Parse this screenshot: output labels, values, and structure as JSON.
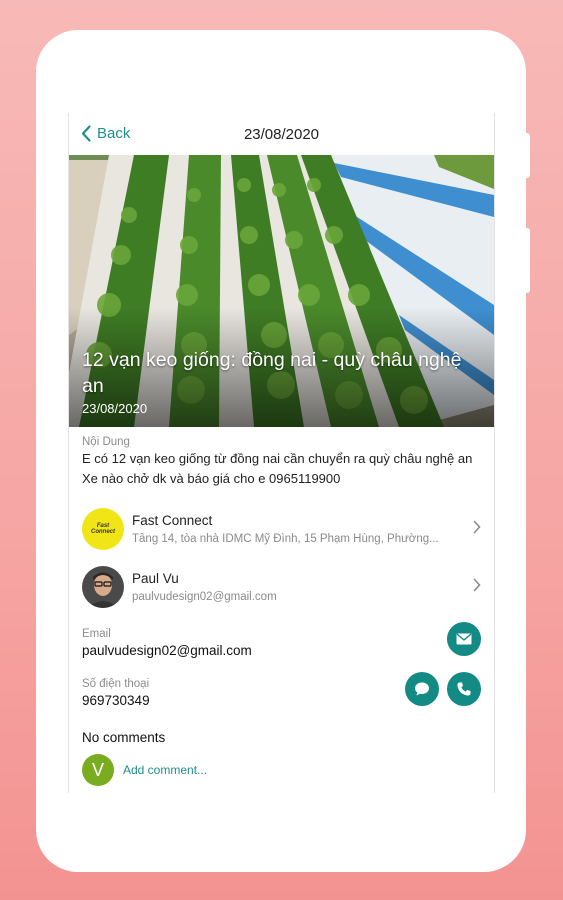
{
  "header": {
    "back_label": "Back",
    "date": "23/08/2020"
  },
  "post": {
    "title": "12 vạn keo giống: đồng nai  - quỳ châu nghệ an",
    "date": "23/08/2020",
    "content_label": "Nội Dung",
    "content_line1": "E có 12 vạn keo giống từ đồng nai cần chuyển ra quỳ châu nghệ an",
    "content_line2": "Xe nào chở dk và báo giá cho e 0965119900"
  },
  "company": {
    "logo_text_1": "Fast",
    "logo_text_2": "Connect",
    "name": "Fast Connect",
    "address": "Tầng 14, tòa nhà IDMC Mỹ Đình, 15 Phạm Hùng, Phường..."
  },
  "user": {
    "name": "Paul Vu",
    "email": "paulvudesign02@gmail.com"
  },
  "contact": {
    "email_label": "Email",
    "email_value": "paulvudesign02@gmail.com",
    "phone_label": "Số điện thoại",
    "phone_value": "969730349"
  },
  "comments": {
    "title": "No comments",
    "avatar_letter": "V",
    "add_label": "Add comment..."
  },
  "colors": {
    "accent": "#138a84",
    "background": "#f6a5a3",
    "avatar_green": "#7aac1f",
    "logo_yellow": "#f2e515"
  }
}
